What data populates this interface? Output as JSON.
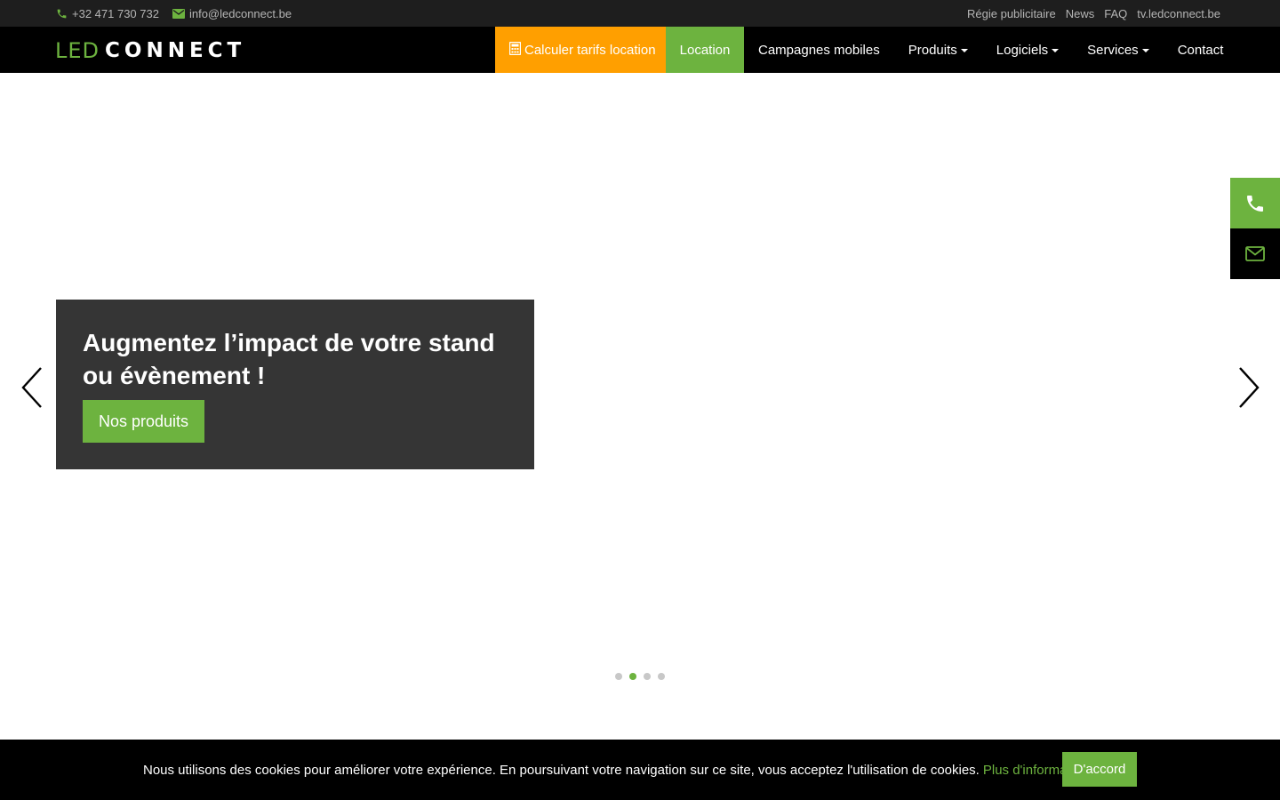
{
  "topbar": {
    "phone": "+32 471 730 732",
    "email": "info@ledconnect.be",
    "links": [
      "Régie publicitaire",
      "News",
      "FAQ",
      "tv.ledconnect.be"
    ]
  },
  "logo": {
    "led": "LED",
    "connect": "CONNECT"
  },
  "nav": {
    "calc": "Calculer tarifs location",
    "location": "Location",
    "campagnes": "Campagnes mobiles",
    "produits": "Produits",
    "logiciels": "Logiciels",
    "services": "Services",
    "contact": "Contact"
  },
  "hero": {
    "title": "Augmentez l’impact de votre stand ou évènement !",
    "button": "Nos produits",
    "slides_total": 4,
    "active_slide": 2
  },
  "cookie": {
    "text": "Nous utilisons des cookies pour améliorer votre expérience. En poursuivant votre navigation sur ce site, vous acceptez l'utilisation de cookies.",
    "more": "Plus d'informations",
    "accept": "D'accord"
  },
  "colors": {
    "accent_green": "#6db33f",
    "accent_orange": "#ff9f00",
    "topbar_bg": "#1e1e1e",
    "nav_bg": "#000000",
    "caption_bg": "#353535"
  },
  "icons": [
    "phone-icon",
    "envelope-icon",
    "calculator-icon",
    "chevron-left-icon",
    "chevron-right-icon"
  ]
}
